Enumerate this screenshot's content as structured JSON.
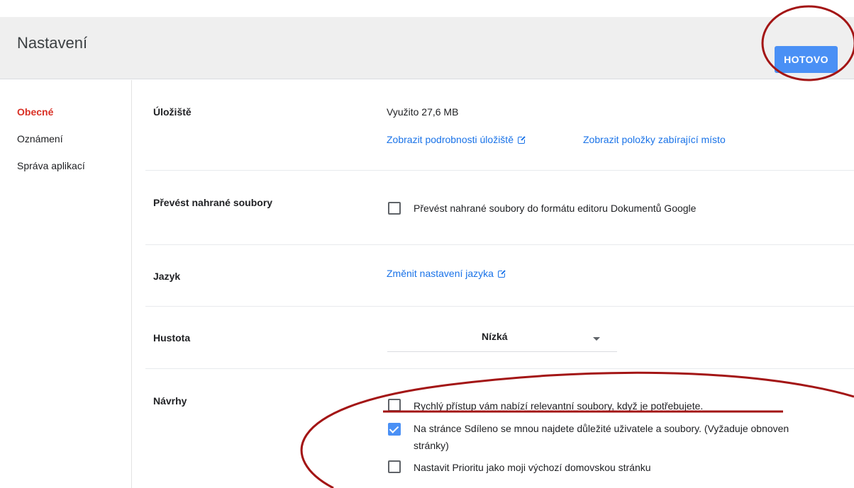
{
  "header": {
    "title": "Nastavení",
    "done_label": "HOTOVO"
  },
  "sidebar": {
    "items": [
      {
        "label": "Obecné",
        "active": true
      },
      {
        "label": "Oznámení",
        "active": false
      },
      {
        "label": "Správa aplikací",
        "active": false
      }
    ]
  },
  "storage": {
    "label": "Úložiště",
    "used": "Využito 27,6 MB",
    "details_link": "Zobrazit podrobnosti úložiště",
    "items_link": "Zobrazit položky zabírající místo"
  },
  "convert": {
    "label": "Převést nahrané soubory",
    "option": "Převést nahrané soubory do formátu editoru Dokumentů Google",
    "checked": false
  },
  "language": {
    "label": "Jazyk",
    "link": "Změnit nastavení jazyka"
  },
  "density": {
    "label": "Hustota",
    "value": "Nízká"
  },
  "suggestions": {
    "label": "Návrhy",
    "options": [
      {
        "text": "Rychlý přístup vám nabízí relevantní soubory, když je potřebujete.",
        "checked": false
      },
      {
        "text": "Na stránce Sdíleno se mnou najdete důležité uživatele a soubory. (Vyžaduje obnoven",
        "text_line2": "stránky)",
        "checked": true
      },
      {
        "text": "Nastavit Prioritu jako moji výchozí domovskou stránku",
        "checked": false
      }
    ]
  },
  "colors": {
    "accent": "#4a90f5",
    "link": "#1a73e8",
    "active_nav": "#d93025",
    "annotation": "#a31515"
  }
}
